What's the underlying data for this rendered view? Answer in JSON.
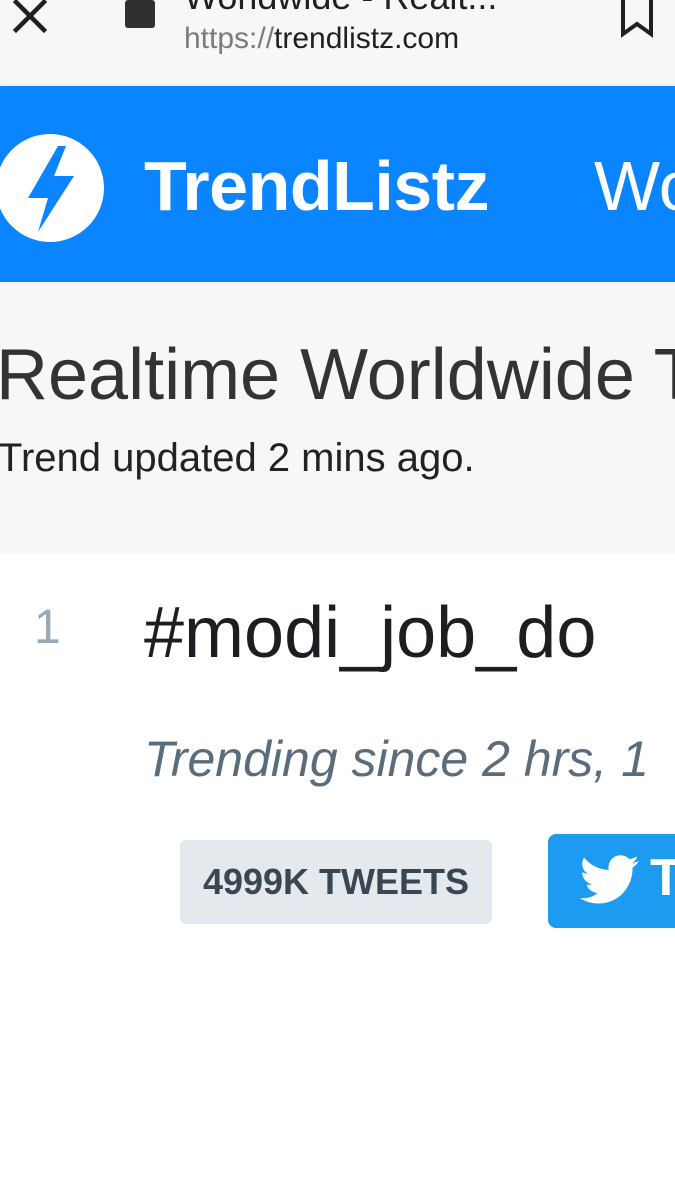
{
  "browser": {
    "tab_title": "Worldwide - Realt...",
    "url_scheme": "https://",
    "url_host": "trendlistz.com",
    "icons": [
      "close-icon",
      "lock-icon",
      "bookmark-icon"
    ]
  },
  "header": {
    "brand": "TrendListz",
    "nav_item": "Wo",
    "colors": {
      "header_bg": "#0a84ff",
      "brand_text": "#ffffff"
    }
  },
  "hero": {
    "title": "Realtime Worldwide T",
    "updated": "Trend updated 2 mins ago."
  },
  "trends": [
    {
      "rank": "1",
      "hashtag": "#modi_job_do",
      "since": "Trending since 2 hrs, 1",
      "tweets": "4999K TWEETS",
      "tweet_button_label": "T"
    }
  ],
  "colors": {
    "badge_bg": "#e4e9ee",
    "tweet_button_bg": "#1d9bf0",
    "muted_text": "#5b6c7c"
  }
}
